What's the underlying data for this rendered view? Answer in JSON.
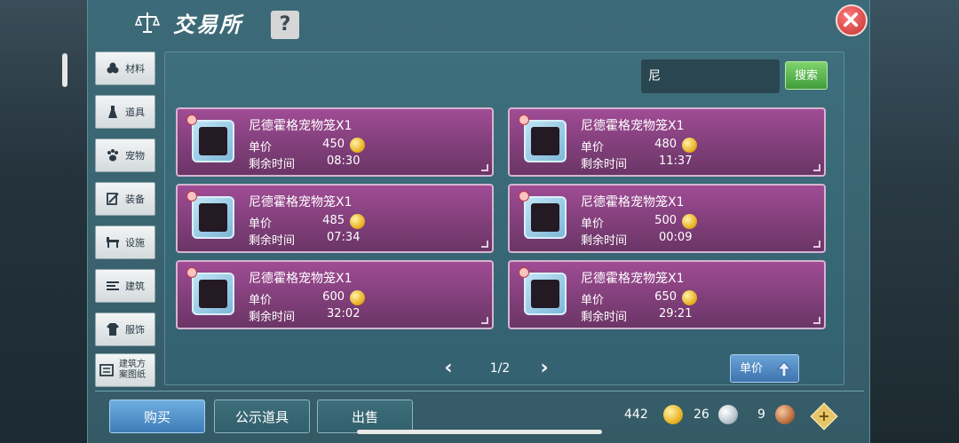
{
  "title": "交易所",
  "help_label": "?",
  "categories": [
    {
      "label": "材料",
      "icon": "materials-icon"
    },
    {
      "label": "道具",
      "icon": "potion-icon"
    },
    {
      "label": "宠物",
      "icon": "paw-icon"
    },
    {
      "label": "装备",
      "icon": "equipment-icon"
    },
    {
      "label": "设施",
      "icon": "facility-icon"
    },
    {
      "label": "建筑",
      "icon": "building-icon"
    },
    {
      "label": "服饰",
      "icon": "clothing-icon"
    },
    {
      "label": "建筑方案图纸",
      "icon": "blueprint-icon"
    }
  ],
  "search": {
    "value": "尼",
    "button_label": "搜索"
  },
  "labels": {
    "unit_price": "单价",
    "remaining_time": "剩余时间"
  },
  "items": [
    {
      "name": "尼德霍格宠物笼X1",
      "price": "450",
      "time": "08:30"
    },
    {
      "name": "尼德霍格宠物笼X1",
      "price": "480",
      "time": "11:37"
    },
    {
      "name": "尼德霍格宠物笼X1",
      "price": "485",
      "time": "07:34"
    },
    {
      "name": "尼德霍格宠物笼X1",
      "price": "500",
      "time": "00:09"
    },
    {
      "name": "尼德霍格宠物笼X1",
      "price": "600",
      "time": "32:02"
    },
    {
      "name": "尼德霍格宠物笼X1",
      "price": "650",
      "time": "29:21"
    }
  ],
  "pagination": {
    "text": "1/2",
    "prev": "‹",
    "next": "›"
  },
  "sort_label": "单价",
  "tabs": {
    "buy": "购买",
    "public": "公示道具",
    "sell": "出售"
  },
  "currency": {
    "gold": "442",
    "silver": "26",
    "bronze": "9"
  },
  "colors": {
    "accent_green": "#3f9d3b",
    "accent_blue": "#3f74b0",
    "card_purple": "#813f7a"
  }
}
